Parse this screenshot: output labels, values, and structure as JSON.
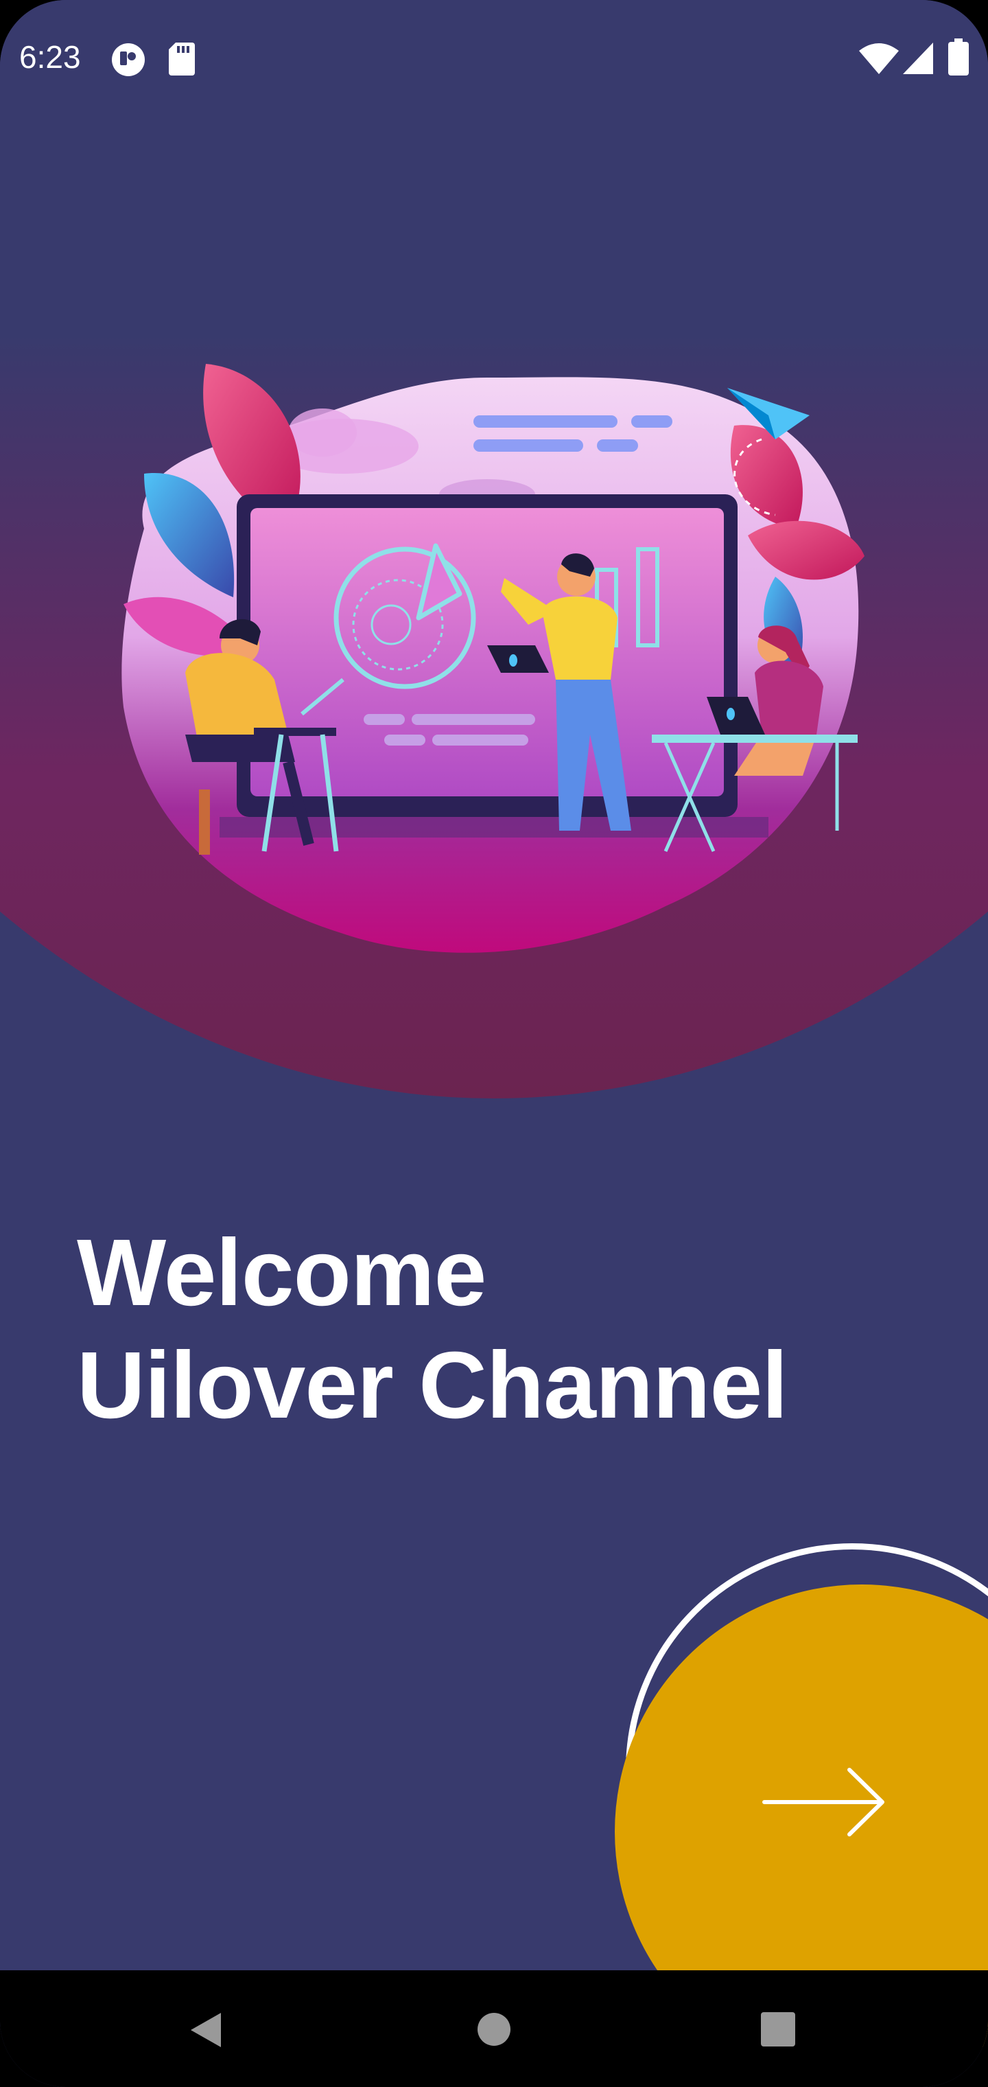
{
  "status_bar": {
    "time": "6:23",
    "left_icons": [
      "notification-app-icon",
      "sd-card-icon"
    ],
    "right_icons": [
      "wifi-icon",
      "cell-signal-icon",
      "battery-icon"
    ]
  },
  "hero": {
    "illustration": "team-presentation-illustration"
  },
  "welcome": {
    "line1": "Welcome",
    "line2": "Uilover Channel"
  },
  "next_button": {
    "icon": "arrow-right-icon"
  },
  "nav_bar": {
    "buttons": [
      "back-icon",
      "home-icon",
      "recents-icon"
    ]
  },
  "colors": {
    "background": "#383a6d",
    "accent": "#dea200",
    "arc_bottom": "#6e2660",
    "text": "#ffffff"
  }
}
